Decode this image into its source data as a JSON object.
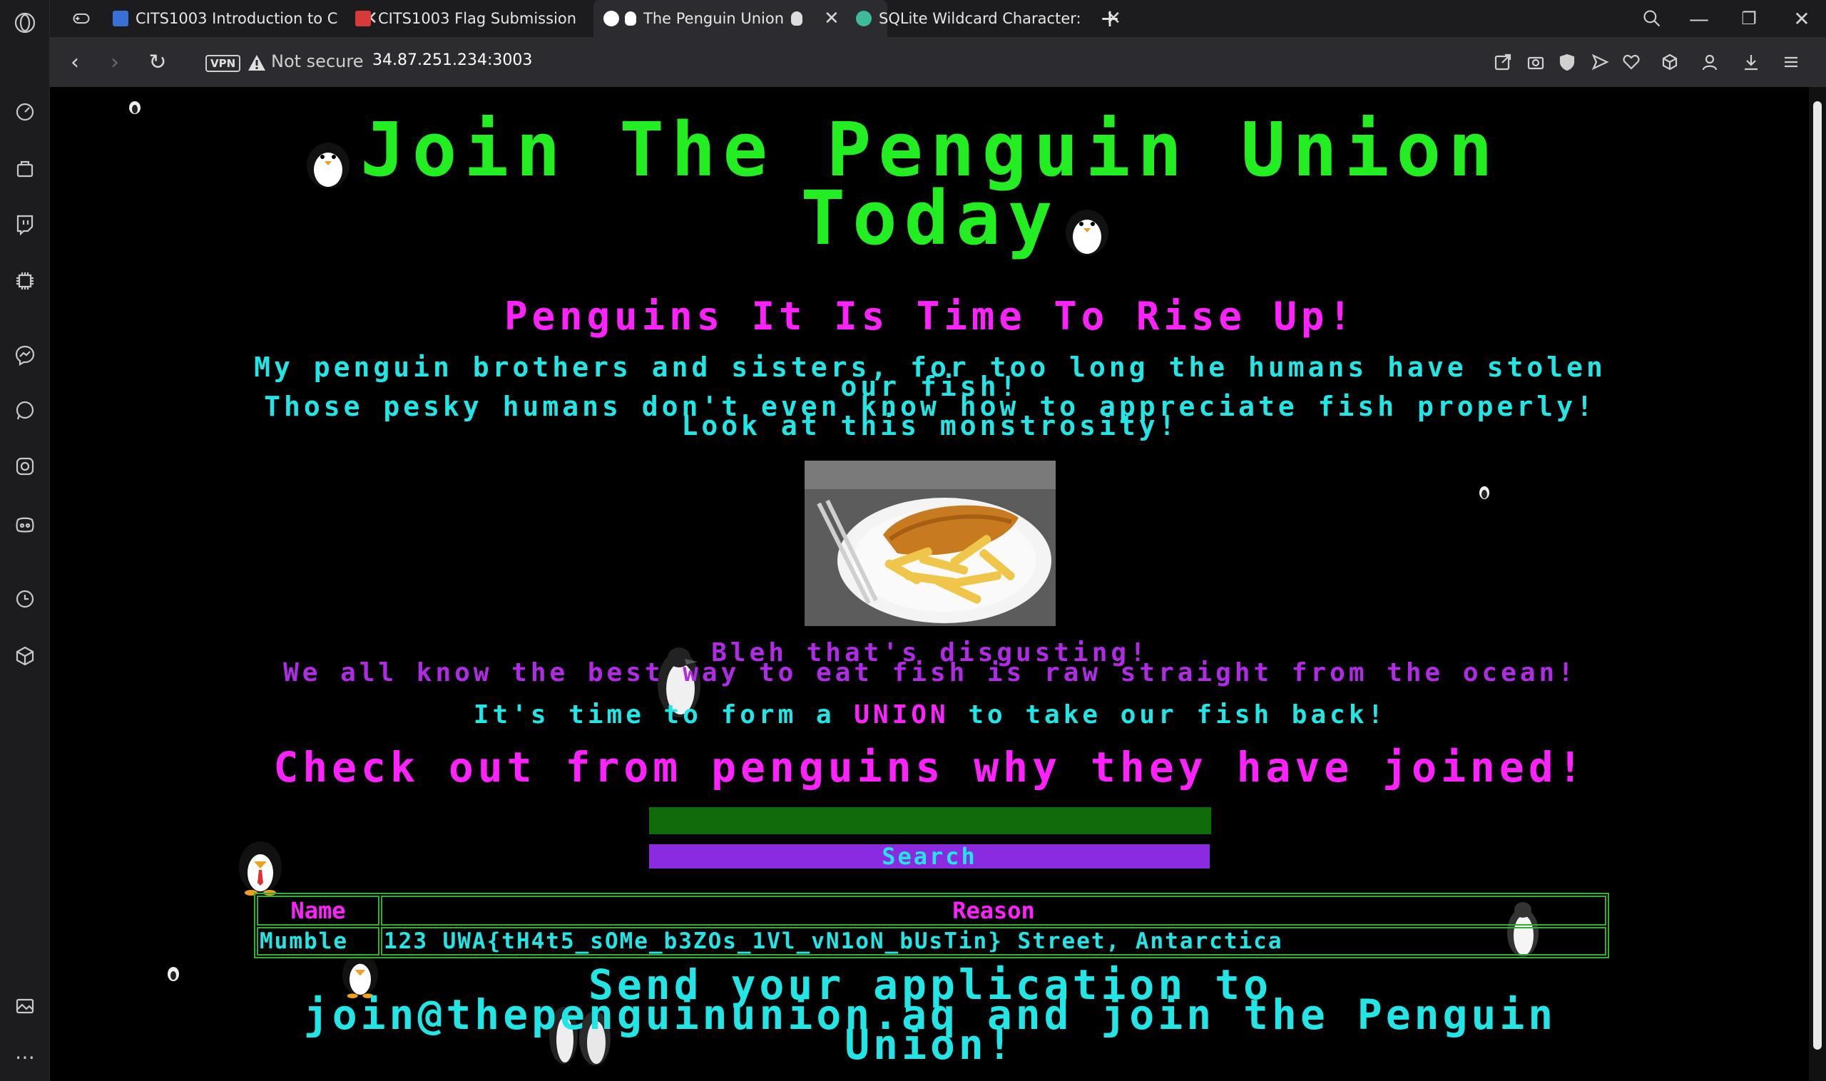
{
  "tabs": [
    {
      "label": "CITS1003 Introduction to C",
      "favicon_color": "#3a6fd8"
    },
    {
      "label": "CITS1003 Flag Submission",
      "favicon_color": "#d83a3a"
    },
    {
      "label": "The Penguin Union",
      "favicon_color": "#ffffff"
    },
    {
      "label": "SQLite Wildcard Character:",
      "favicon_color": "#3dbb9b"
    }
  ],
  "new_tab_glyph": "+",
  "address_bar": {
    "vpn_label": "VPN",
    "security_label": "Not secure",
    "url": "34.87.251.234:3003"
  },
  "page": {
    "title": "Join The Penguin Union Today",
    "heading_rise": "Penguins It Is Time To Rise Up!",
    "para1_line1": "My penguin brothers and sisters, for too long the humans have stolen",
    "para1_line2": "our fish!",
    "para2_line1": "Those pesky humans don't even know how to appreciate fish properly!",
    "para2_line2": "Look at this monstrosity!",
    "disgust_line": "Bleh that's disgusting!",
    "raw_line": "We all know the best way to eat fish is raw straight from the ocean!",
    "union_pre": "It's time to form a ",
    "union_word": "UNION",
    "union_post": " to take our fish back!",
    "check_heading": "Check out from penguins why they have joined!",
    "search_value": "",
    "search_button": "Search",
    "table_headers": [
      "Name",
      "Reason"
    ],
    "table_rows": [
      {
        "name": "Mumble",
        "reason": "123 UWA{tH4t5_sOMe_b3ZOs_1Vl_vN1oN_bUsTin} Street, Antarctica"
      }
    ],
    "footer_line1": "Send your application to",
    "footer_line2": "join@thepenguinunion.aq and join the Penguin",
    "footer_line3": "Union!"
  },
  "colors": {
    "title_green": "#22ee22",
    "magenta": "#ff22ff",
    "cyan": "#22e6e6",
    "purple": "#b12be6",
    "search_green": "#126b0a",
    "search_button": "#8a2be2"
  }
}
